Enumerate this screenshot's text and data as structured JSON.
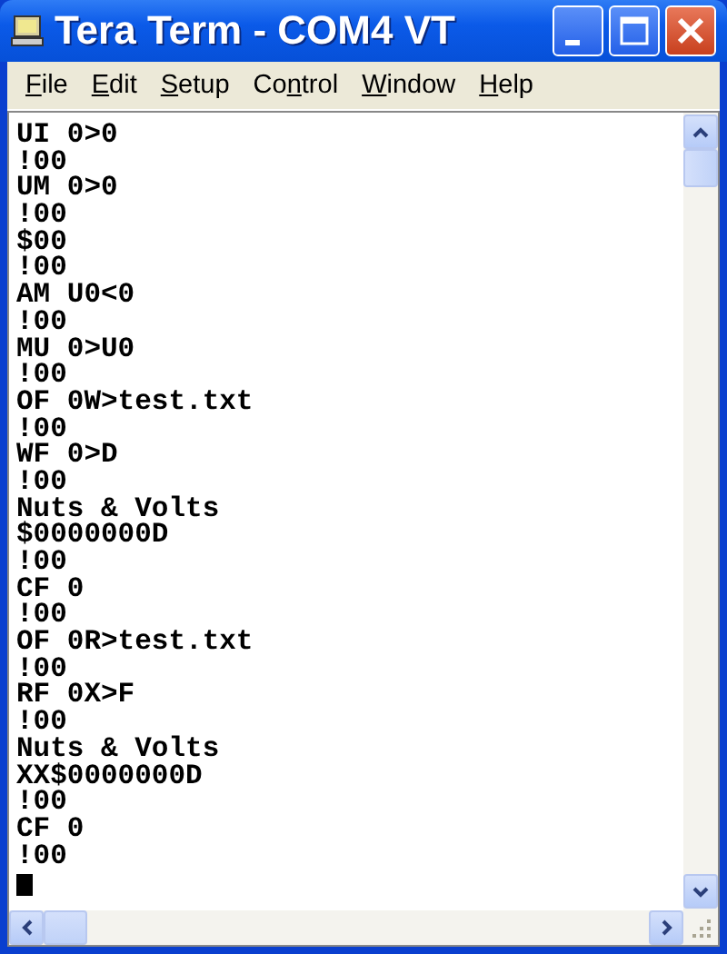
{
  "window": {
    "title": "Tera Term - COM4 VT"
  },
  "menu": [
    {
      "key": "F",
      "after": "ile"
    },
    {
      "key": "E",
      "after": "dit"
    },
    {
      "key": "S",
      "after": "etup"
    },
    {
      "before": "Co",
      "key": "n",
      "after": "trol"
    },
    {
      "key": "W",
      "after": "indow"
    },
    {
      "key": "H",
      "after": "elp"
    }
  ],
  "terminal": {
    "lines": [
      "UI 0>0",
      "!00",
      "UM 0>0",
      "!00",
      "$00",
      "!00",
      "AM U0<0",
      "!00",
      "MU 0>U0",
      "!00",
      "OF 0W>test.txt",
      "!00",
      "WF 0>D",
      "!00",
      "Nuts & Volts",
      "$0000000D",
      "!00",
      "CF 0",
      "!00",
      "OF 0R>test.txt",
      "!00",
      "RF 0X>F",
      "!00",
      "Nuts & Volts",
      "XX$0000000D",
      "!00",
      "CF 0",
      "!00"
    ],
    "cursor": true
  }
}
